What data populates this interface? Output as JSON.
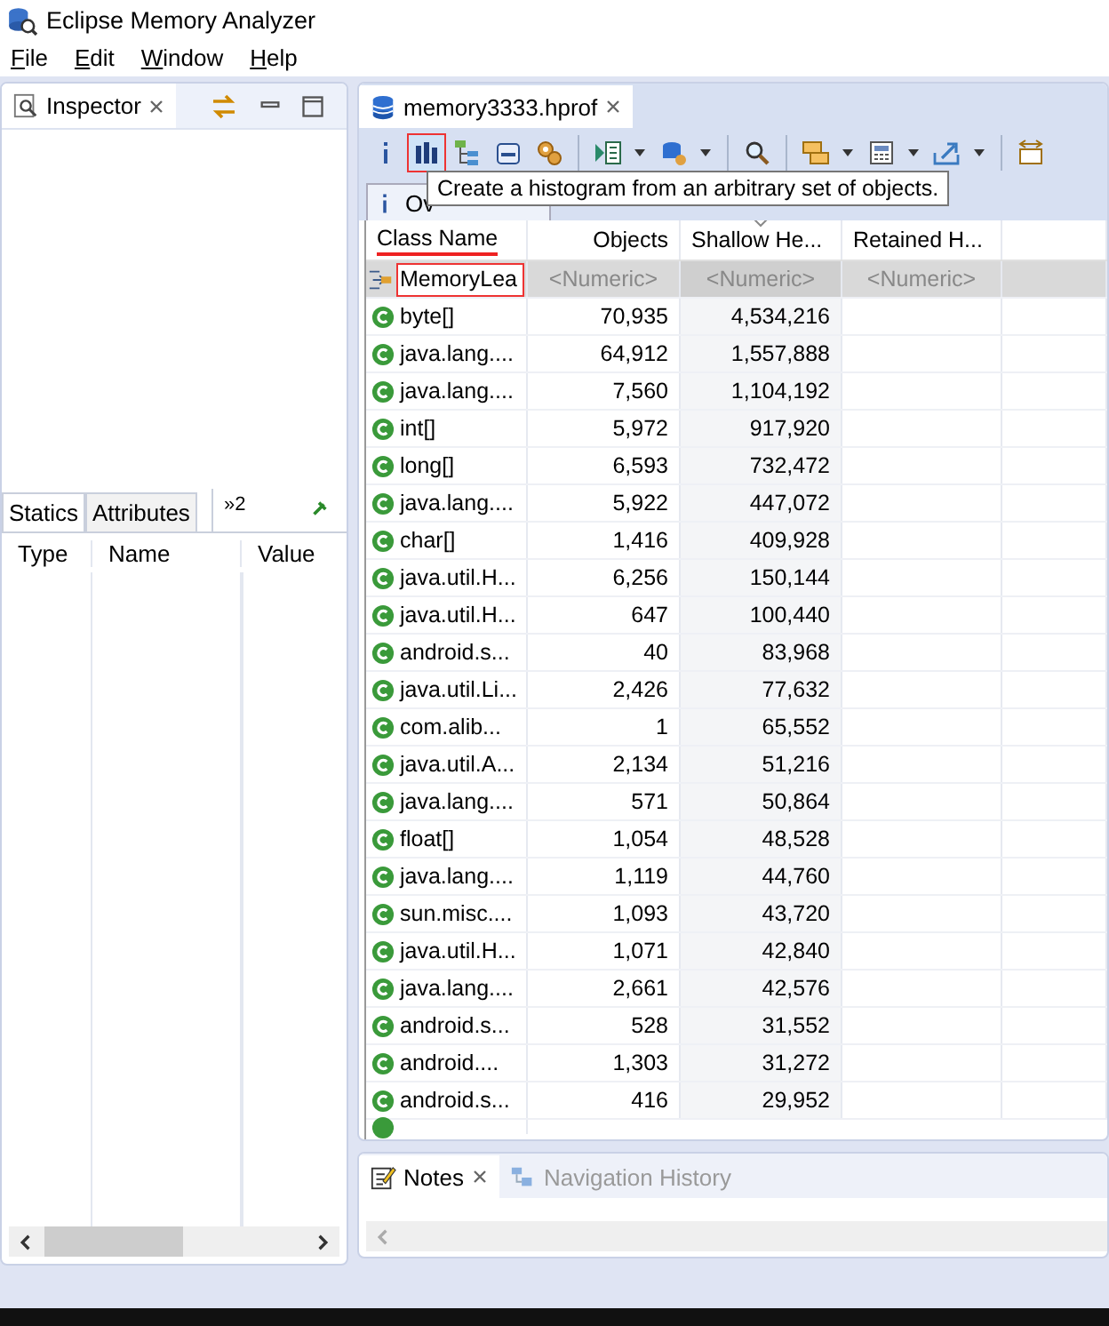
{
  "window": {
    "title": "Eclipse Memory Analyzer"
  },
  "menu": [
    {
      "label": "File"
    },
    {
      "label": "Edit"
    },
    {
      "label": "Window"
    },
    {
      "label": "Help"
    }
  ],
  "inspector": {
    "title": "Inspector",
    "tabs": [
      {
        "label": "Statics",
        "selected": true
      },
      {
        "label": "Attributes",
        "selected": false
      }
    ],
    "overflow": "»",
    "overflow_count": "2",
    "columns": [
      "Type",
      "Name",
      "Value"
    ]
  },
  "editor": {
    "tab": "memory3333.hprof",
    "toolbar": [
      {
        "kind": "info",
        "dropdown": false,
        "selected": false
      },
      {
        "kind": "histogram",
        "dropdown": false,
        "selected": true
      },
      {
        "kind": "tree",
        "dropdown": false,
        "selected": false
      },
      {
        "kind": "oql",
        "dropdown": false,
        "selected": false
      },
      {
        "kind": "gears",
        "dropdown": false,
        "selected": false
      },
      {
        "kind": "sep"
      },
      {
        "kind": "report",
        "dropdown": true,
        "selected": false
      },
      {
        "kind": "dbgear",
        "dropdown": true,
        "selected": false
      },
      {
        "kind": "sep"
      },
      {
        "kind": "search",
        "dropdown": false,
        "selected": false
      },
      {
        "kind": "sep"
      },
      {
        "kind": "group",
        "dropdown": true,
        "selected": false
      },
      {
        "kind": "calc",
        "dropdown": true,
        "selected": false
      },
      {
        "kind": "export",
        "dropdown": true,
        "selected": false
      },
      {
        "kind": "sep"
      },
      {
        "kind": "swap",
        "dropdown": false,
        "selected": false
      }
    ],
    "tooltip": "Create a histogram from an arbitrary set of objects.",
    "subtab": "Ov",
    "table": {
      "columns": [
        {
          "label": "Class Name",
          "sorted": false,
          "annotated": true
        },
        {
          "label": "Objects",
          "sorted": false,
          "annotated": false
        },
        {
          "label": "Shallow He...",
          "sorted": true,
          "annotated": false
        },
        {
          "label": "Retained H...",
          "sorted": false,
          "annotated": false
        }
      ],
      "filter": {
        "value": "MemoryLea",
        "placeholders": [
          "<Numeric>",
          "<Numeric>",
          "<Numeric>"
        ]
      },
      "rows": [
        [
          "byte[]",
          "70,935",
          "4,534,216"
        ],
        [
          "java.lang....",
          "64,912",
          "1,557,888"
        ],
        [
          "java.lang....",
          "7,560",
          "1,104,192"
        ],
        [
          "int[]",
          "5,972",
          "917,920"
        ],
        [
          "long[]",
          "6,593",
          "732,472"
        ],
        [
          "java.lang....",
          "5,922",
          "447,072"
        ],
        [
          "char[]",
          "1,416",
          "409,928"
        ],
        [
          "java.util.H...",
          "6,256",
          "150,144"
        ],
        [
          "java.util.H...",
          "647",
          "100,440"
        ],
        [
          "android.s...",
          "40",
          "83,968"
        ],
        [
          "java.util.Li...",
          "2,426",
          "77,632"
        ],
        [
          "com.alib...",
          "1",
          "65,552"
        ],
        [
          "java.util.A...",
          "2,134",
          "51,216"
        ],
        [
          "java.lang....",
          "571",
          "50,864"
        ],
        [
          "float[]",
          "1,054",
          "48,528"
        ],
        [
          "java.lang....",
          "1,119",
          "44,760"
        ],
        [
          "sun.misc....",
          "1,093",
          "43,720"
        ],
        [
          "java.util.H...",
          "1,071",
          "42,840"
        ],
        [
          "java.lang....",
          "2,661",
          "42,576"
        ],
        [
          "android.s...",
          "528",
          "31,552"
        ],
        [
          "android....",
          "1,303",
          "31,272"
        ],
        [
          "android.s...",
          "416",
          "29,952"
        ]
      ]
    }
  },
  "bottom": {
    "tabs": [
      {
        "label": "Notes",
        "selected": true
      },
      {
        "label": "Navigation History",
        "selected": false
      }
    ]
  }
}
